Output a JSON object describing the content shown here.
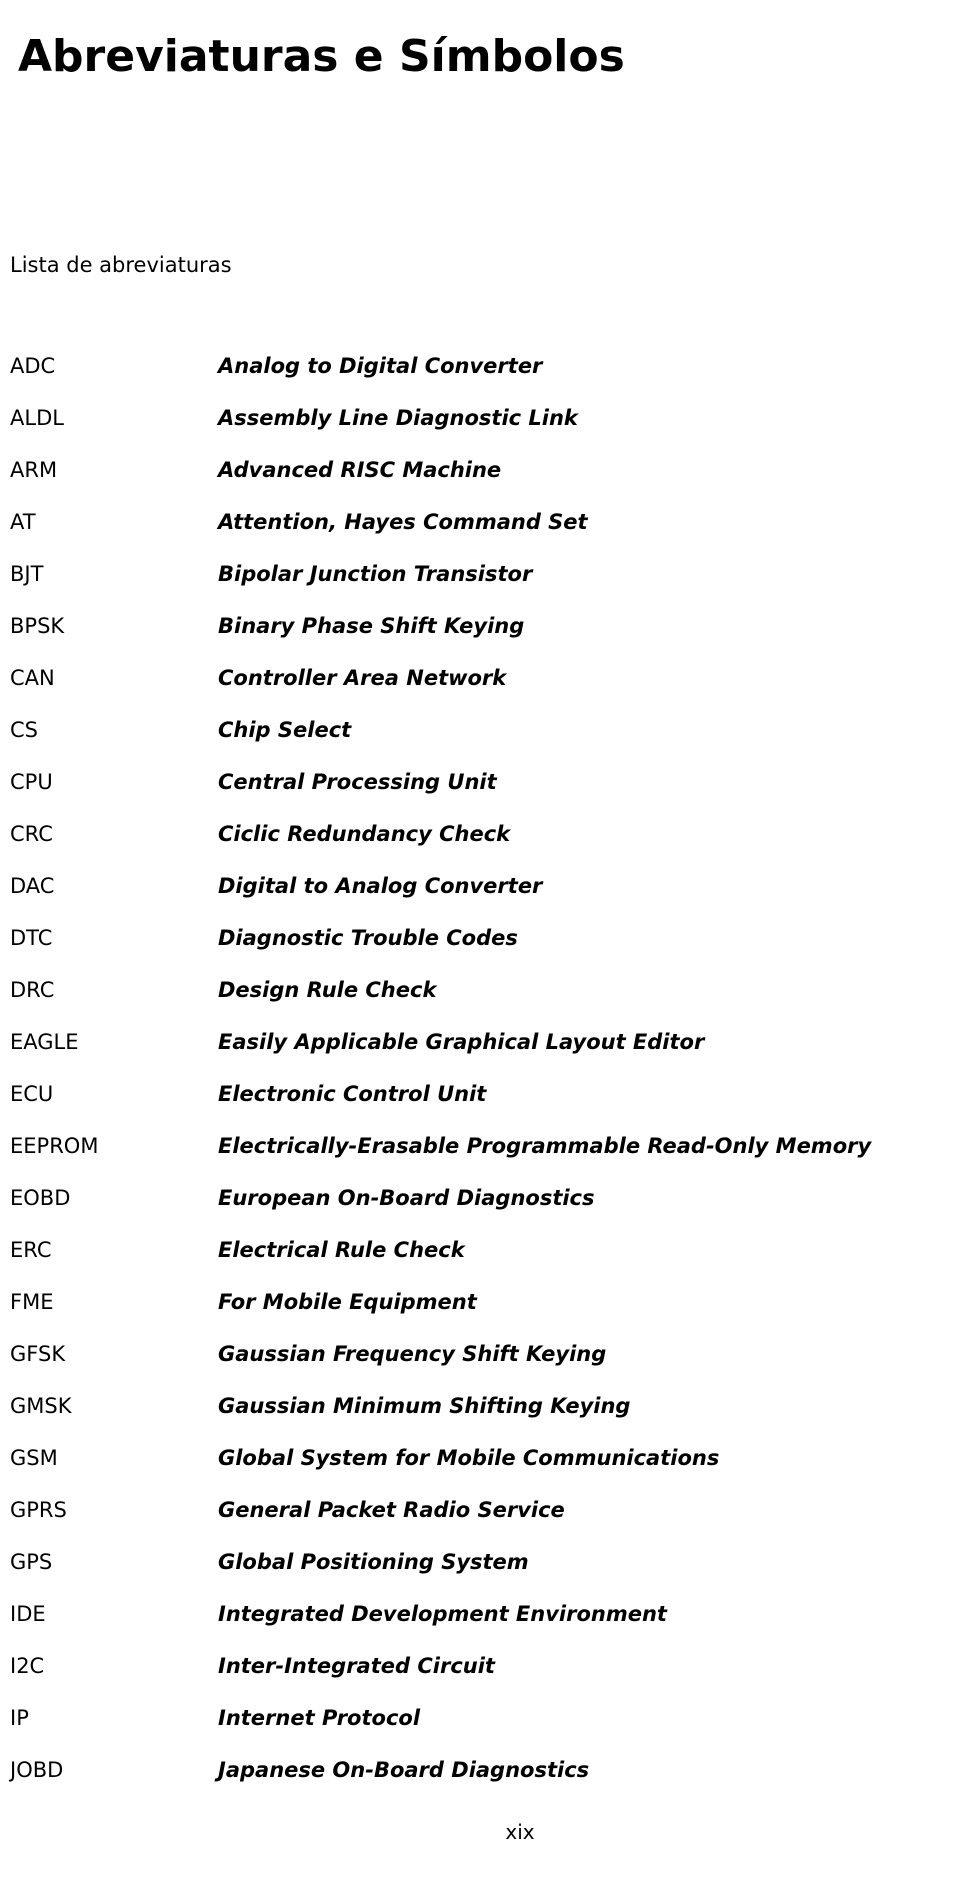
{
  "document": {
    "title": "Abreviaturas e Símbolos",
    "section_heading": "Lista de abreviaturas",
    "page_number": "xix"
  },
  "abbreviations": [
    {
      "term": "ADC",
      "definition": "Analog to Digital Converter"
    },
    {
      "term": "ALDL",
      "definition": "Assembly Line Diagnostic Link"
    },
    {
      "term": "ARM",
      "definition": "Advanced RISC Machine"
    },
    {
      "term": "AT",
      "definition": "Attention, Hayes Command Set"
    },
    {
      "term": "BJT",
      "definition": "Bipolar Junction Transistor"
    },
    {
      "term": "BPSK",
      "definition": "Binary Phase Shift Keying"
    },
    {
      "term": "CAN",
      "definition": "Controller Area Network"
    },
    {
      "term": "CS",
      "definition": "Chip Select"
    },
    {
      "term": "CPU",
      "definition": "Central Processing Unit"
    },
    {
      "term": "CRC",
      "definition": "Ciclic Redundancy Check"
    },
    {
      "term": "DAC",
      "definition": "Digital to Analog Converter"
    },
    {
      "term": "DTC",
      "definition": "Diagnostic Trouble Codes"
    },
    {
      "term": "DRC",
      "definition": "Design Rule Check"
    },
    {
      "term": "EAGLE",
      "definition": "Easily Applicable Graphical Layout Editor"
    },
    {
      "term": "ECU",
      "definition": "Electronic Control Unit"
    },
    {
      "term": "EEPROM",
      "definition": "Electrically-Erasable Programmable Read-Only Memory"
    },
    {
      "term": "EOBD",
      "definition": "European On-Board Diagnostics"
    },
    {
      "term": "ERC",
      "definition": "Electrical Rule Check"
    },
    {
      "term": "FME",
      "definition": "For Mobile Equipment"
    },
    {
      "term": "GFSK",
      "definition": "Gaussian Frequency Shift Keying"
    },
    {
      "term": "GMSK",
      "definition": "Gaussian Minimum Shifting Keying"
    },
    {
      "term": "GSM",
      "definition": "Global System for Mobile Communications"
    },
    {
      "term": "GPRS",
      "definition": "General Packet Radio Service"
    },
    {
      "term": "GPS",
      "definition": "Global Positioning System"
    },
    {
      "term": "IDE",
      "definition": "Integrated Development Environment"
    },
    {
      "term": "I2C",
      "definition": "Inter-Integrated Circuit"
    },
    {
      "term": "IP",
      "definition": "Internet Protocol"
    },
    {
      "term": "JOBD",
      "definition": "Japanese On-Board Diagnostics"
    }
  ]
}
